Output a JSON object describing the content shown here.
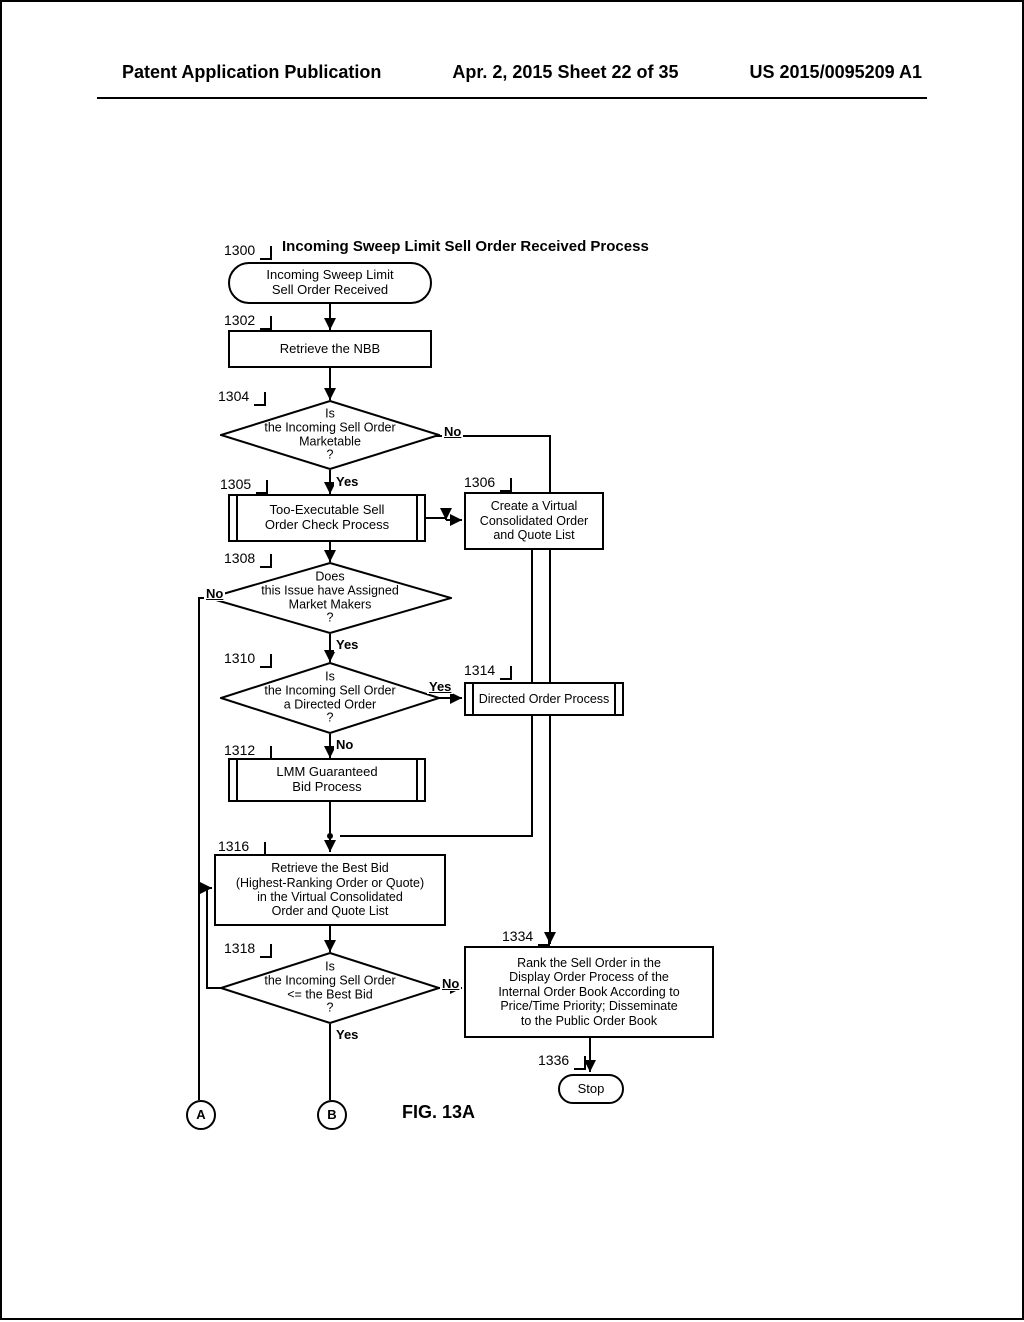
{
  "header": {
    "left": "Patent Application Publication",
    "center": "Apr. 2, 2015  Sheet 22 of 35",
    "right": "US 2015/0095209 A1"
  },
  "title": "Incoming Sweep Limit Sell Order Received Process",
  "refs": {
    "r1300": "1300",
    "r1302": "1302",
    "r1304": "1304",
    "r1305": "1305",
    "r1306": "1306",
    "r1308": "1308",
    "r1310": "1310",
    "r1312": "1312",
    "r1314": "1314",
    "r1316": "1316",
    "r1318": "1318",
    "r1334": "1334",
    "r1336": "1336"
  },
  "nodes": {
    "n1300": "Incoming Sweep Limit\nSell Order Received",
    "n1302": "Retrieve the NBB",
    "n1304": "Is\nthe Incoming Sell Order\nMarketable\n?",
    "n1305": "Too-Executable Sell\nOrder Check Process",
    "n1306": "Create a Virtual\nConsolidated Order\nand Quote List",
    "n1308": "Does\nthis Issue have Assigned\nMarket Makers\n?",
    "n1310": "Is\nthe Incoming Sell Order\na Directed Order\n?",
    "n1312": "LMM Guaranteed\nBid Process",
    "n1314": "Directed Order Process",
    "n1316": "Retrieve the Best Bid\n(Highest-Ranking Order or Quote)\nin the Virtual Consolidated\nOrder and Quote List",
    "n1318": "Is\nthe Incoming Sell Order\n<= the Best Bid\n?",
    "n1334": "Rank the Sell Order in the\nDisplay Order Process of the\nInternal Order Book According to\nPrice/Time Priority; Disseminate\nto the Public Order Book",
    "n1336": "Stop"
  },
  "labels": {
    "yes": "Yes",
    "no": "No"
  },
  "connectors": {
    "a": "A",
    "b": "B"
  },
  "figure": "FIG. 13A"
}
